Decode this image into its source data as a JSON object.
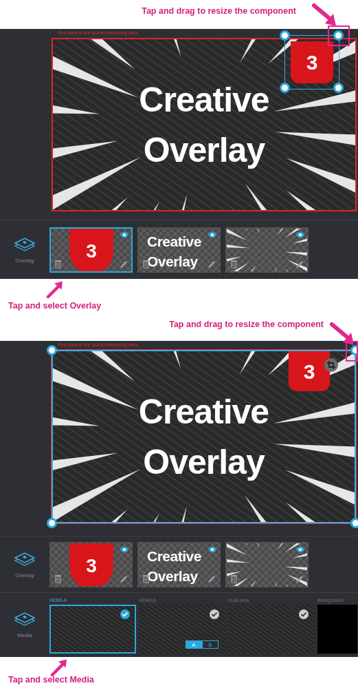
{
  "screens": [
    {
      "annotation_top": "Tap and drag to resize the component",
      "canvas": {
        "note": "Red area is the actual streaming area.",
        "title_lines": [
          "Creative",
          "Overlay"
        ],
        "badge": "3",
        "badge_selected": true,
        "frame_selected": false
      },
      "overlay_strip": {
        "label": "Overlay",
        "items": [
          {
            "kind": "badge",
            "text": "3",
            "selected": true
          },
          {
            "kind": "text",
            "lines": [
              "Creative",
              "Overlay"
            ],
            "selected": false
          },
          {
            "kind": "burst",
            "selected": false
          }
        ]
      },
      "annotation_bottom": "Tap and select Overlay"
    },
    {
      "annotation_top": "Tap and drag to resize the component",
      "canvas": {
        "note": "Red area is the actual streaming area.",
        "title_lines": [
          "Creative",
          "Overlay"
        ],
        "badge": "3",
        "badge_selected": false,
        "frame_selected": true
      },
      "overlay_strip": {
        "label": "Overlay",
        "items": [
          {
            "kind": "badge",
            "text": "3",
            "selected": false
          },
          {
            "kind": "text",
            "lines": [
              "Creative",
              "Overlay"
            ],
            "selected": false
          },
          {
            "kind": "burst",
            "selected": false
          }
        ]
      },
      "media_strip": {
        "label": "Media",
        "items": [
          {
            "label": "HDMI-A",
            "kind": "video",
            "selected": true
          },
          {
            "label": "HDMI-B",
            "kind": "video",
            "selected": false,
            "toggle": [
              {
                "text": "A",
                "selected": true
              },
              {
                "text": "B",
                "selected": false
              }
            ]
          },
          {
            "label": "Dual-view",
            "kind": "video",
            "selected": false
          },
          {
            "label": "Background",
            "kind": "black",
            "selected": false
          }
        ]
      },
      "annotation_bottom": "Tap and select Media"
    }
  ]
}
